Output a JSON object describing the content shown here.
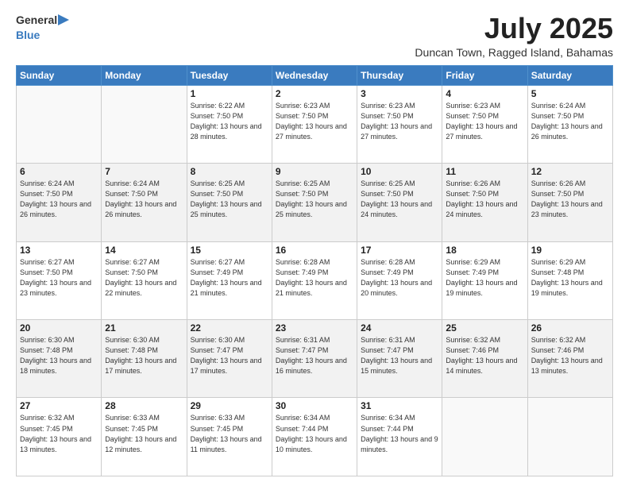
{
  "header": {
    "logo": {
      "line1": "General",
      "line2": "Blue"
    },
    "title": "July 2025",
    "location": "Duncan Town, Ragged Island, Bahamas"
  },
  "weekdays": [
    "Sunday",
    "Monday",
    "Tuesday",
    "Wednesday",
    "Thursday",
    "Friday",
    "Saturday"
  ],
  "weeks": [
    [
      {
        "day": "",
        "info": ""
      },
      {
        "day": "",
        "info": ""
      },
      {
        "day": "1",
        "info": "Sunrise: 6:22 AM\nSunset: 7:50 PM\nDaylight: 13 hours and 28 minutes."
      },
      {
        "day": "2",
        "info": "Sunrise: 6:23 AM\nSunset: 7:50 PM\nDaylight: 13 hours and 27 minutes."
      },
      {
        "day": "3",
        "info": "Sunrise: 6:23 AM\nSunset: 7:50 PM\nDaylight: 13 hours and 27 minutes."
      },
      {
        "day": "4",
        "info": "Sunrise: 6:23 AM\nSunset: 7:50 PM\nDaylight: 13 hours and 27 minutes."
      },
      {
        "day": "5",
        "info": "Sunrise: 6:24 AM\nSunset: 7:50 PM\nDaylight: 13 hours and 26 minutes."
      }
    ],
    [
      {
        "day": "6",
        "info": "Sunrise: 6:24 AM\nSunset: 7:50 PM\nDaylight: 13 hours and 26 minutes."
      },
      {
        "day": "7",
        "info": "Sunrise: 6:24 AM\nSunset: 7:50 PM\nDaylight: 13 hours and 26 minutes."
      },
      {
        "day": "8",
        "info": "Sunrise: 6:25 AM\nSunset: 7:50 PM\nDaylight: 13 hours and 25 minutes."
      },
      {
        "day": "9",
        "info": "Sunrise: 6:25 AM\nSunset: 7:50 PM\nDaylight: 13 hours and 25 minutes."
      },
      {
        "day": "10",
        "info": "Sunrise: 6:25 AM\nSunset: 7:50 PM\nDaylight: 13 hours and 24 minutes."
      },
      {
        "day": "11",
        "info": "Sunrise: 6:26 AM\nSunset: 7:50 PM\nDaylight: 13 hours and 24 minutes."
      },
      {
        "day": "12",
        "info": "Sunrise: 6:26 AM\nSunset: 7:50 PM\nDaylight: 13 hours and 23 minutes."
      }
    ],
    [
      {
        "day": "13",
        "info": "Sunrise: 6:27 AM\nSunset: 7:50 PM\nDaylight: 13 hours and 23 minutes."
      },
      {
        "day": "14",
        "info": "Sunrise: 6:27 AM\nSunset: 7:50 PM\nDaylight: 13 hours and 22 minutes."
      },
      {
        "day": "15",
        "info": "Sunrise: 6:27 AM\nSunset: 7:49 PM\nDaylight: 13 hours and 21 minutes."
      },
      {
        "day": "16",
        "info": "Sunrise: 6:28 AM\nSunset: 7:49 PM\nDaylight: 13 hours and 21 minutes."
      },
      {
        "day": "17",
        "info": "Sunrise: 6:28 AM\nSunset: 7:49 PM\nDaylight: 13 hours and 20 minutes."
      },
      {
        "day": "18",
        "info": "Sunrise: 6:29 AM\nSunset: 7:49 PM\nDaylight: 13 hours and 19 minutes."
      },
      {
        "day": "19",
        "info": "Sunrise: 6:29 AM\nSunset: 7:48 PM\nDaylight: 13 hours and 19 minutes."
      }
    ],
    [
      {
        "day": "20",
        "info": "Sunrise: 6:30 AM\nSunset: 7:48 PM\nDaylight: 13 hours and 18 minutes."
      },
      {
        "day": "21",
        "info": "Sunrise: 6:30 AM\nSunset: 7:48 PM\nDaylight: 13 hours and 17 minutes."
      },
      {
        "day": "22",
        "info": "Sunrise: 6:30 AM\nSunset: 7:47 PM\nDaylight: 13 hours and 17 minutes."
      },
      {
        "day": "23",
        "info": "Sunrise: 6:31 AM\nSunset: 7:47 PM\nDaylight: 13 hours and 16 minutes."
      },
      {
        "day": "24",
        "info": "Sunrise: 6:31 AM\nSunset: 7:47 PM\nDaylight: 13 hours and 15 minutes."
      },
      {
        "day": "25",
        "info": "Sunrise: 6:32 AM\nSunset: 7:46 PM\nDaylight: 13 hours and 14 minutes."
      },
      {
        "day": "26",
        "info": "Sunrise: 6:32 AM\nSunset: 7:46 PM\nDaylight: 13 hours and 13 minutes."
      }
    ],
    [
      {
        "day": "27",
        "info": "Sunrise: 6:32 AM\nSunset: 7:45 PM\nDaylight: 13 hours and 13 minutes."
      },
      {
        "day": "28",
        "info": "Sunrise: 6:33 AM\nSunset: 7:45 PM\nDaylight: 13 hours and 12 minutes."
      },
      {
        "day": "29",
        "info": "Sunrise: 6:33 AM\nSunset: 7:45 PM\nDaylight: 13 hours and 11 minutes."
      },
      {
        "day": "30",
        "info": "Sunrise: 6:34 AM\nSunset: 7:44 PM\nDaylight: 13 hours and 10 minutes."
      },
      {
        "day": "31",
        "info": "Sunrise: 6:34 AM\nSunset: 7:44 PM\nDaylight: 13 hours and 9 minutes."
      },
      {
        "day": "",
        "info": ""
      },
      {
        "day": "",
        "info": ""
      }
    ]
  ]
}
